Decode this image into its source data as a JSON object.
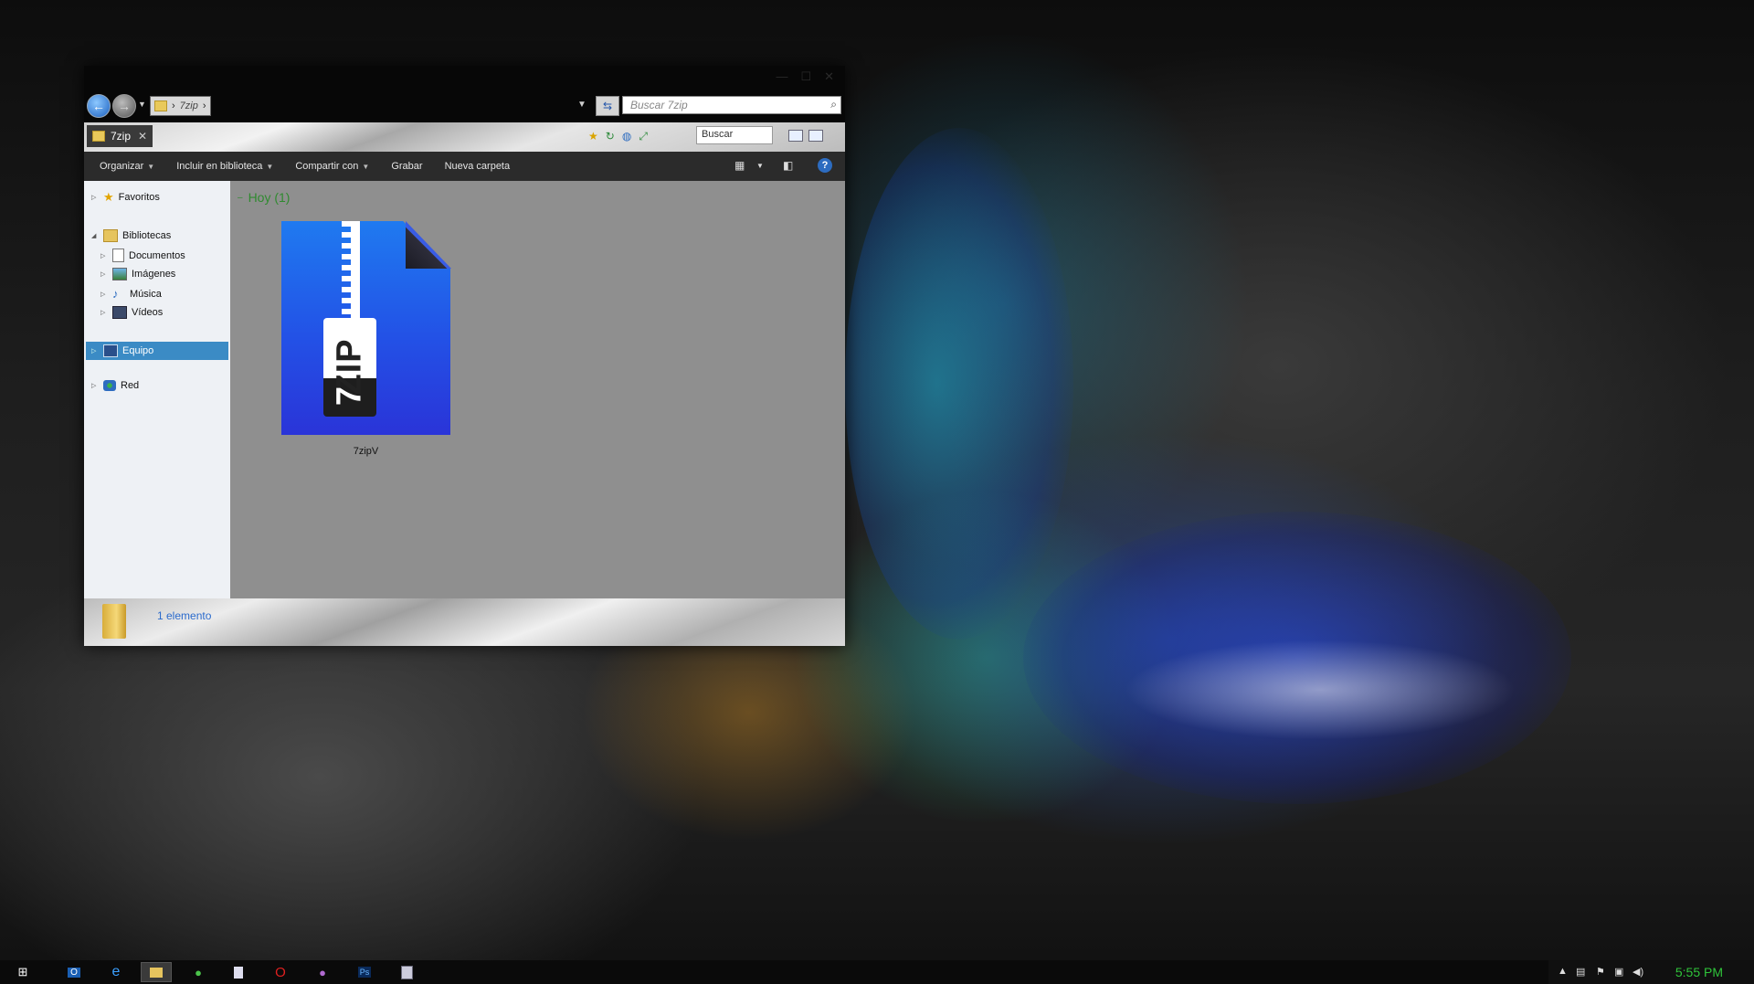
{
  "window": {
    "address_segment": "7zip",
    "search_placeholder": "Buscar 7zip",
    "tab_title": "7zip",
    "small_search_value": "Buscar"
  },
  "toolbar": {
    "organize": "Organizar",
    "include_library": "Incluir en biblioteca",
    "share_with": "Compartir con",
    "burn": "Grabar",
    "new_folder": "Nueva carpeta"
  },
  "navpane": {
    "favorites": "Favoritos",
    "libraries": "Bibliotecas",
    "documents": "Documentos",
    "images": "Imágenes",
    "music": "Música",
    "videos": "Vídeos",
    "computer": "Equipo",
    "network": "Red"
  },
  "content": {
    "group_header": "Hoy (1)",
    "file_name": "7zipV",
    "icon_label": "ZIP",
    "icon_number": "7"
  },
  "status": {
    "count": "1 elemento"
  },
  "taskbar": {
    "apps": [
      "start-icon",
      "outlook-icon",
      "internet-explorer-icon",
      "file-explorer-icon",
      "utorrent-icon",
      "notepad-icon",
      "opera-icon",
      "app-icon",
      "photoshop-icon",
      "document-app-icon"
    ],
    "clock": "5:55 PM"
  },
  "colors": {
    "accent_blue": "#3b8bc5",
    "group_green": "#2f8a2f",
    "clock_green": "#2fc43a",
    "zip_blue": "#2351e6"
  }
}
